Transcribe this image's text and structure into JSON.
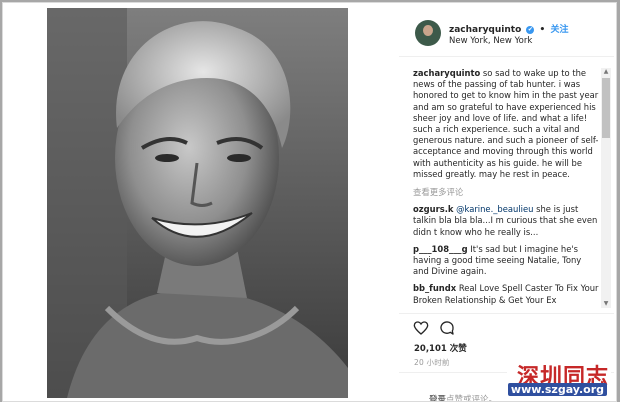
{
  "header": {
    "username": "zacharyquinto",
    "verified_symbol": "✔",
    "dot": "•",
    "follow": "关注",
    "location": "New York, New York"
  },
  "caption": {
    "username": "zacharyquinto",
    "text": "so sad to wake up to the news of the passing of tab hunter. i was honored to get to know him in the past year and am so grateful to have experienced his sheer joy and love of life. and what a life! such a rich experience. such a vital and generous nature. and such a pioneer of self-acceptance and moving through this world with authenticity as his guide. he will be missed greatly. may he rest in peace."
  },
  "load_more": "查看更多评论",
  "comments": [
    {
      "username": "ozgurs.k",
      "mention": "@karine._beaulieu",
      "text": "she is just talkin bla bla bla...I m curious that she even didn t know who he really is..."
    },
    {
      "username": "p___108___g",
      "mention": "",
      "text": "It's sad but I imagine he's having a good time seeing Natalie, Tony and Divine again."
    },
    {
      "username": "bb_fundx",
      "mention": "",
      "text": "Real Love Spell Caster To Fix Your Broken Relationship & Get Your Ex"
    }
  ],
  "likes": "20,101 次赞",
  "time": "20 小时前",
  "login": {
    "link": "登录",
    "rest": "后可点赞或评论。"
  },
  "watermark": {
    "title": "深圳同志",
    "url": "www.szgay.org"
  },
  "colors": {
    "accent": "#3897f0",
    "watermark_red": "#c62828",
    "watermark_blue": "#2f4f9f"
  }
}
